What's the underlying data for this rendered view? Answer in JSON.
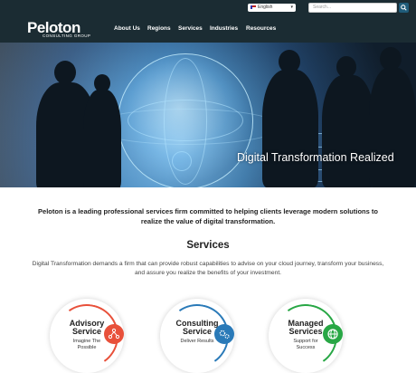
{
  "header": {
    "logo": "Peloton",
    "logo_sub": "CONSULTING GROUP",
    "language": "English",
    "search_placeholder": "Search...",
    "nav": [
      "About Us",
      "Regions",
      "Services",
      "Industries",
      "Resources"
    ]
  },
  "hero": {
    "title": "Digital Transformation Realized",
    "slides": 5
  },
  "intro": "Peloton is a leading professional services firm committed to helping clients leverage modern solutions to realize the value of digital transformation.",
  "services": {
    "title": "Services",
    "description": "Digital Transformation demands a firm that can provide robust capabilities to advise on your cloud journey, transform your business, and assure you realize the benefits of your investment.",
    "cards": [
      {
        "name_line1": "Advisory",
        "name_line2": "Service",
        "sub1": "Imagine The",
        "sub2": "Possible",
        "color": "#e8503a",
        "icon": "network-icon"
      },
      {
        "name_line1": "Consulting",
        "name_line2": "Service",
        "sub1": "Deliver Results",
        "sub2": "",
        "color": "#2a7ab8",
        "icon": "gears-icon"
      },
      {
        "name_line1": "Managed",
        "name_line2": "Services",
        "sub1": "Support for",
        "sub2": "Success",
        "color": "#28a745",
        "icon": "globe-icon"
      }
    ]
  }
}
